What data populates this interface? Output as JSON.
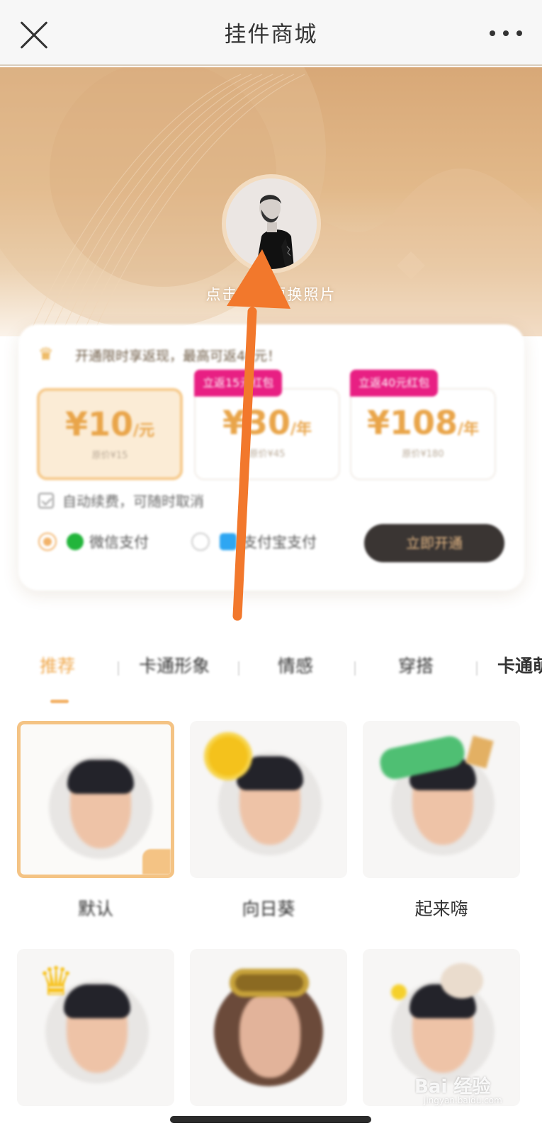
{
  "header": {
    "title": "挂件商城",
    "close_icon": "close-icon",
    "more_icon": "more-dots-icon"
  },
  "hero": {
    "change_photo_text": "点击头像更换照片"
  },
  "vip": {
    "promo_text": "开通限时享返现，最高可返40元！",
    "plans": [
      {
        "price": "¥10",
        "unit": "/元",
        "sub": "原价¥15",
        "badge": "",
        "selected": true
      },
      {
        "price": "¥30",
        "unit": "/年",
        "sub": "原价¥45",
        "badge": "立返15元红包",
        "selected": false
      },
      {
        "price": "¥108",
        "unit": "/年",
        "sub": "原价¥180",
        "badge": "立返40元红包",
        "selected": false
      }
    ],
    "auto_renew_text": "自动续费，可随时取消",
    "pay_wechat": "微信支付",
    "pay_alipay": "支付宝支付",
    "open_button": "立即开通"
  },
  "tabs": [
    "推荐",
    "卡通形象",
    "情感",
    "穿搭",
    "卡通萌"
  ],
  "grid": [
    {
      "caption": "默认",
      "selected": true
    },
    {
      "caption": "向日葵",
      "selected": false
    },
    {
      "caption": "起来嗨",
      "selected": false
    },
    {
      "caption": "",
      "selected": false
    },
    {
      "caption": "",
      "selected": false
    },
    {
      "caption": "",
      "selected": false
    }
  ],
  "watermark": {
    "brand": "Bai 经验",
    "url": "jingyan.baidu.com"
  },
  "colors": {
    "accent": "#f3b46b",
    "hero_gold": "#d8a877",
    "badge_pink": "#e81f83",
    "arrow_orange": "#f2782c",
    "button_dark": "#3a3533"
  }
}
